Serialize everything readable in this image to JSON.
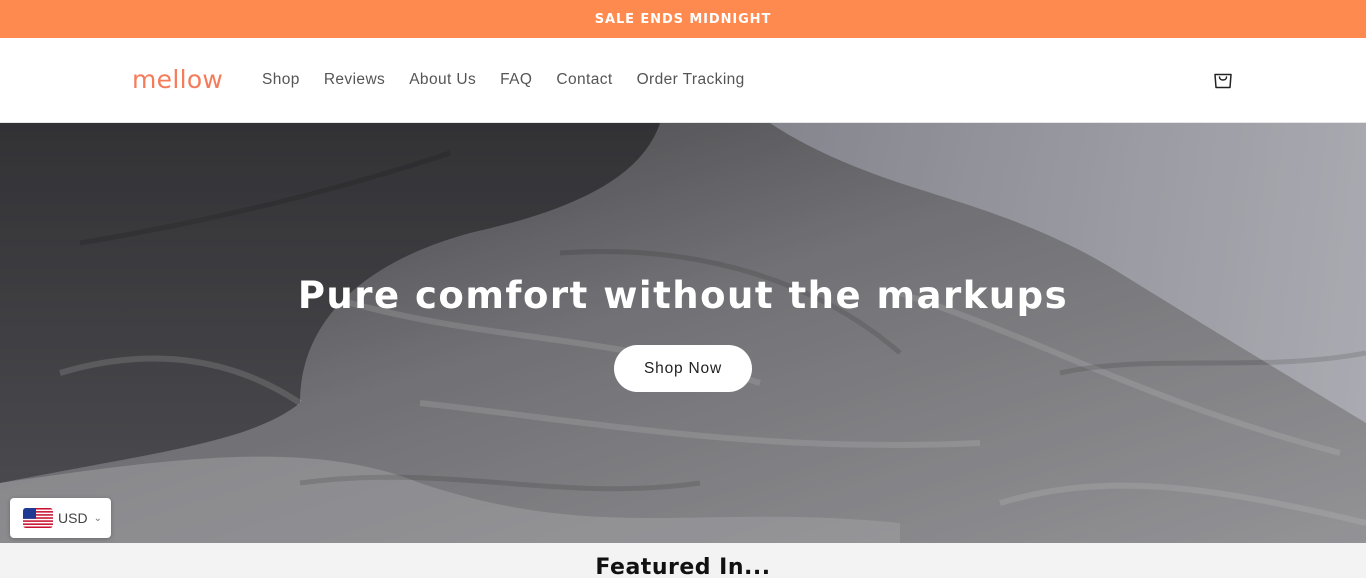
{
  "announcement": {
    "text": "SALE ENDS MIDNIGHT"
  },
  "header": {
    "logo": "mellow",
    "nav": [
      "Shop",
      "Reviews",
      "About Us",
      "FAQ",
      "Contact",
      "Order Tracking"
    ],
    "cart_icon": "shopping-bag-icon"
  },
  "hero": {
    "title": "Pure comfort without the markups",
    "cta_label": "Shop Now",
    "image": "rumpled-bed-sheets-photo"
  },
  "currency": {
    "code": "USD",
    "flag_icon": "us-flag-icon",
    "dropdown_icon": "chevron-down-icon"
  },
  "featured": {
    "title": "Featured In..."
  },
  "colors": {
    "announcement_bg": "#ff8a50",
    "brand": "#f47c5b",
    "nav_text": "#555555",
    "hero_text": "#ffffff",
    "button_bg": "#ffffff",
    "featured_bg": "#f3f3f3"
  }
}
